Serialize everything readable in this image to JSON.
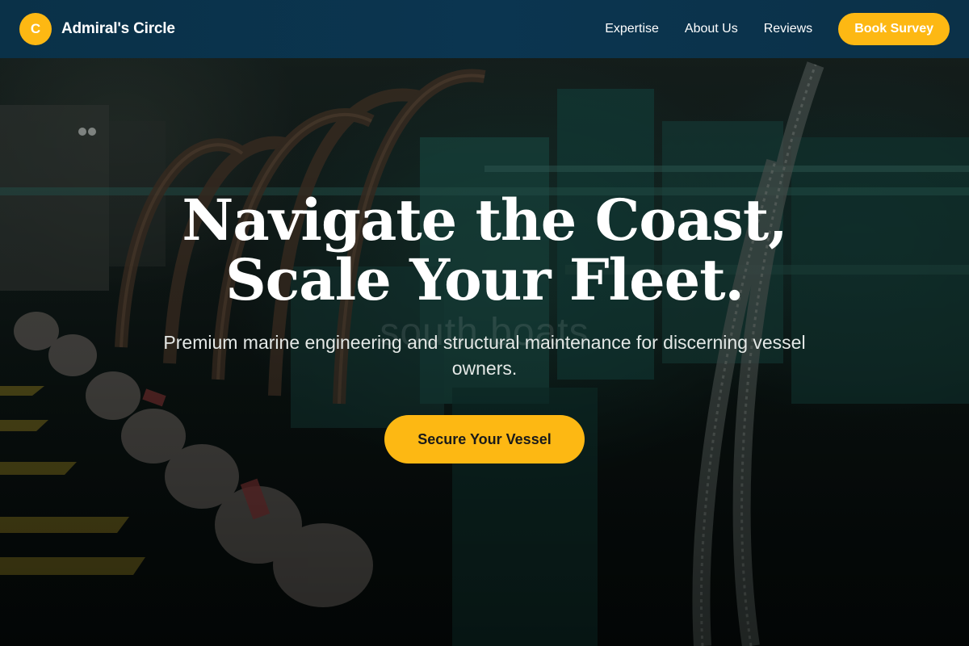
{
  "brand": {
    "logo_letter": "C",
    "name": "Admiral's Circle",
    "accent_color": "#fdb813",
    "nav_color": "#0b3550"
  },
  "nav": {
    "links": [
      {
        "label": "Expertise"
      },
      {
        "label": "About Us"
      },
      {
        "label": "Reviews"
      }
    ],
    "cta_label": "Book Survey"
  },
  "hero": {
    "title": "Navigate the Coast, Scale Your Fleet.",
    "subtitle": "Premium marine engineering and structural maintenance for discerning vessel owners.",
    "cta_label": "Secure Your Vessel",
    "background_image": "engine-room-pipes",
    "watermark_text": "south boats"
  }
}
